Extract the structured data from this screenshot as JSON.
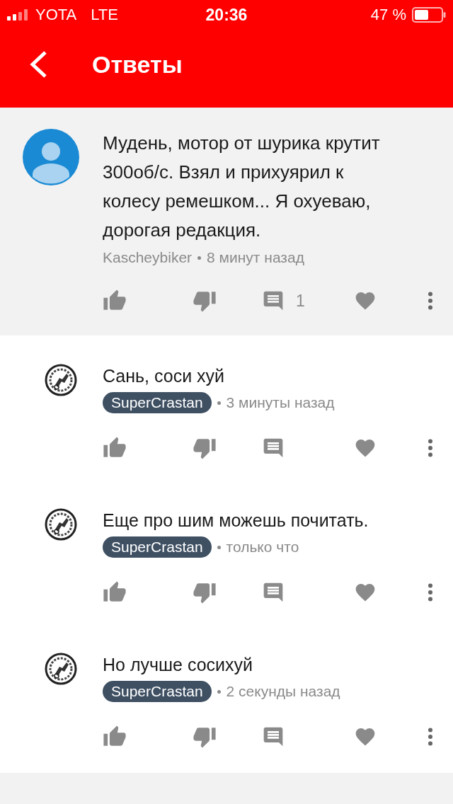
{
  "status_bar": {
    "carrier": "YOTA",
    "network": "LTE",
    "time": "20:36",
    "battery": "47 %"
  },
  "header": {
    "title": "Ответы"
  },
  "comment": {
    "avatar": {
      "kind": "default"
    },
    "text": "Мудень, мотор от шурика крутит 300об/с. Взял и прихуярил к колесу ремешком... Я охуеваю, дорогая редакция.",
    "author": "Kascheybiker",
    "author_highlighted": false,
    "time": "8 минут назад",
    "reply_count": "1"
  },
  "replies": [
    {
      "avatar": {
        "kind": "logo"
      },
      "text": "Сань, соси хуй",
      "author": "SuperCrastan",
      "author_highlighted": true,
      "time": "3 минуты назад"
    },
    {
      "avatar": {
        "kind": "logo"
      },
      "text": "Еще про шим можешь почитать.",
      "author": "SuperCrastan",
      "author_highlighted": true,
      "time": "только что"
    },
    {
      "avatar": {
        "kind": "logo"
      },
      "text": "Но лучше сосихуй",
      "author": "SuperCrastan",
      "author_highlighted": true,
      "time": "2 секунды назад"
    }
  ]
}
